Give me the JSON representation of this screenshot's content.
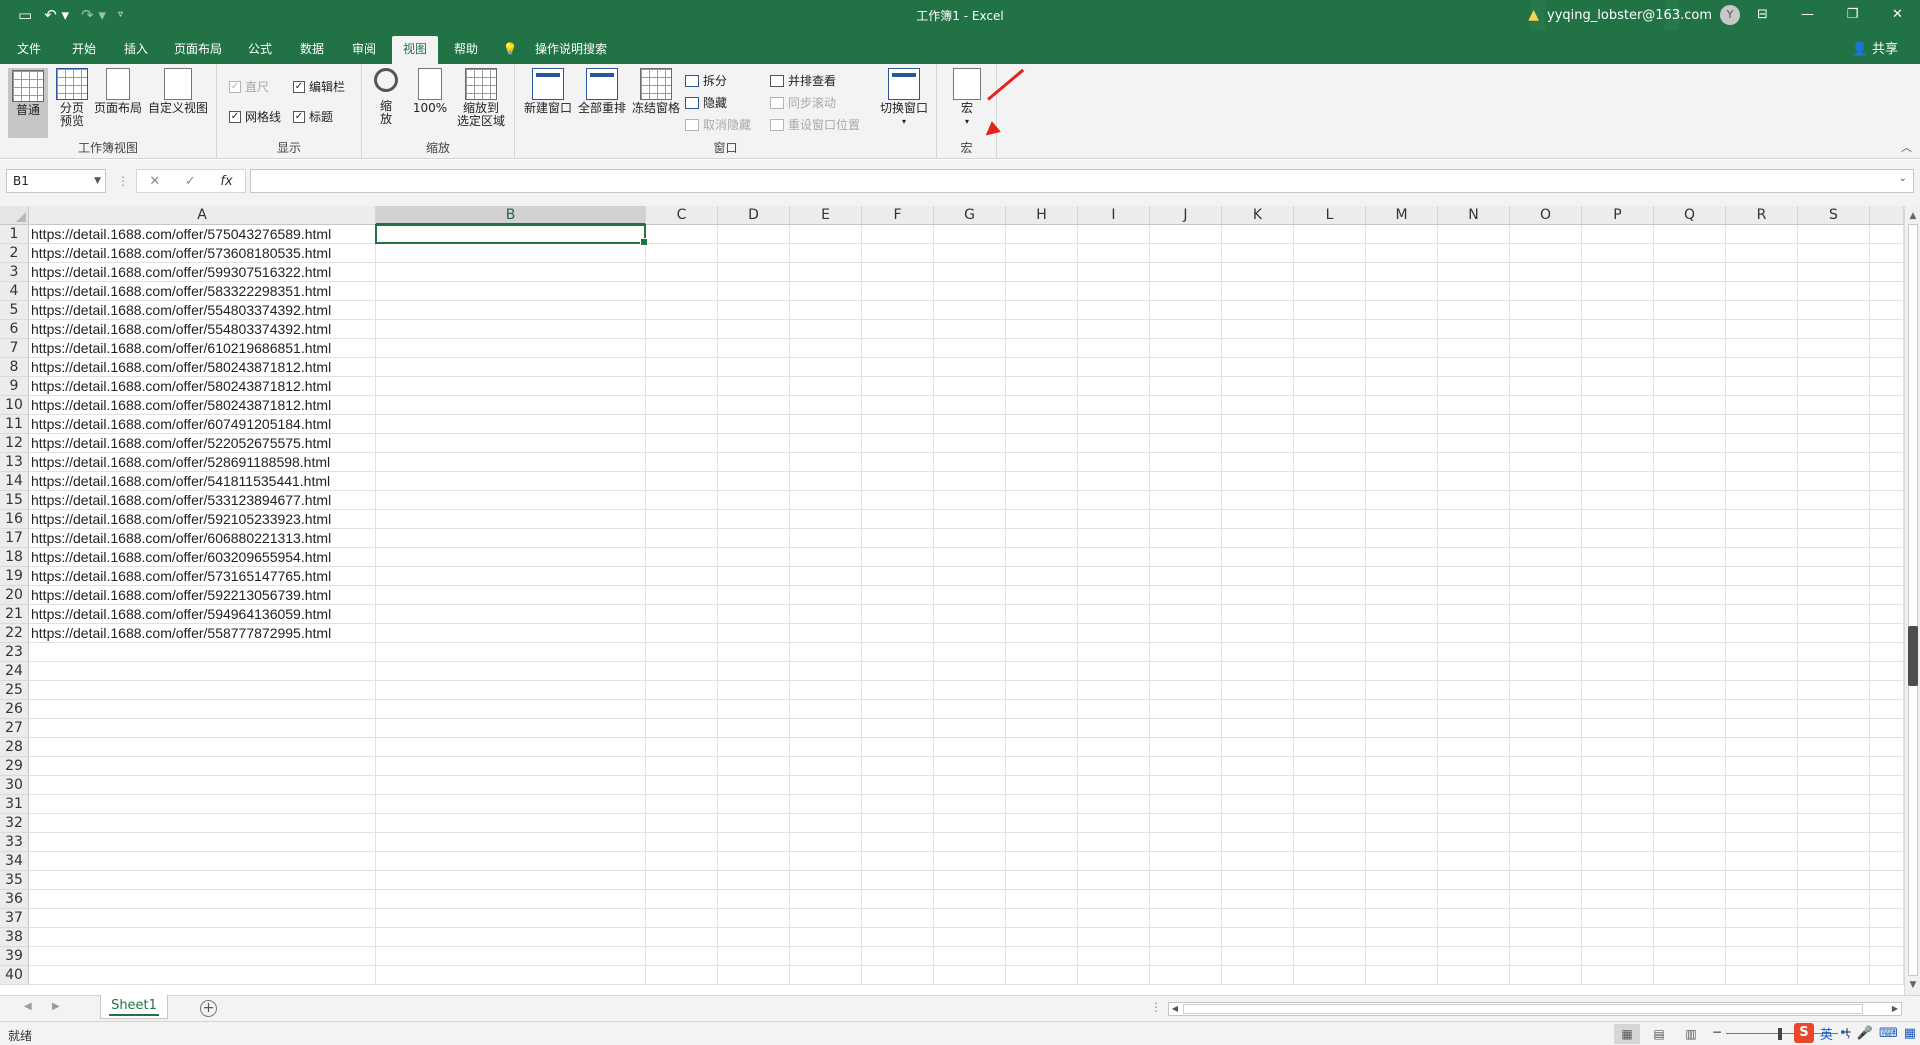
{
  "app": {
    "window_title": "工作簿1  -  Excel",
    "account": "yyqing_lobster@163.com",
    "avatar_initial": "Y",
    "share_label": "共享",
    "accent_color": "#217346"
  },
  "qat": {
    "save_icon": "save-icon",
    "undo_icon": "undo-icon",
    "redo_icon": "redo-icon",
    "customize_icon": "customize-qat-icon"
  },
  "tabs": [
    {
      "label": "文件"
    },
    {
      "label": "开始"
    },
    {
      "label": "插入"
    },
    {
      "label": "页面布局"
    },
    {
      "label": "公式"
    },
    {
      "label": "数据"
    },
    {
      "label": "审阅"
    },
    {
      "label": "视图"
    },
    {
      "label": "帮助"
    },
    {
      "label": "操作说明搜索"
    }
  ],
  "active_tab": "视图",
  "ribbon": {
    "workbook_views": {
      "label": "工作簿视图",
      "normal": "普通",
      "page_break_1": "分页",
      "page_break_2": "预览",
      "page_layout": "页面布局",
      "custom_views": "自定义视图"
    },
    "show": {
      "label": "显示",
      "ruler": "直尺",
      "formula_bar": "编辑栏",
      "gridlines": "网格线",
      "headings": "标题",
      "check": "✓"
    },
    "zoom": {
      "label": "缩放",
      "zoom_1": "缩",
      "zoom_2": "放",
      "zoom100": "100%",
      "zoom_sel_1": "缩放到",
      "zoom_sel_2": "选定区域"
    },
    "window": {
      "label": "窗口",
      "new_window": "新建窗口",
      "arrange_all": "全部重排",
      "freeze_panes": "冻结窗格",
      "split": "拆分",
      "hide": "隐藏",
      "unhide": "取消隐藏",
      "side_by_side": "并排查看",
      "sync_scroll": "同步滚动",
      "reset_position": "重设窗口位置",
      "switch_windows": "切换窗口"
    },
    "macros": {
      "label": "宏",
      "macros_button": "宏"
    }
  },
  "formula_bar": {
    "name_box": "B1",
    "cancel": "✕",
    "enter": "✓",
    "fx": "fx",
    "value": ""
  },
  "columns": [
    "A",
    "B",
    "C",
    "D",
    "E",
    "F",
    "G",
    "H",
    "I",
    "J",
    "K",
    "L",
    "M",
    "N",
    "O",
    "P",
    "Q",
    "R",
    "S"
  ],
  "selected_cell": "B1",
  "rows": [
    "https://detail.1688.com/offer/575043276589.html",
    "https://detail.1688.com/offer/573608180535.html",
    "https://detail.1688.com/offer/599307516322.html",
    "https://detail.1688.com/offer/583322298351.html",
    "https://detail.1688.com/offer/554803374392.html",
    "https://detail.1688.com/offer/554803374392.html",
    "https://detail.1688.com/offer/610219686851.html",
    "https://detail.1688.com/offer/580243871812.html",
    "https://detail.1688.com/offer/580243871812.html",
    "https://detail.1688.com/offer/580243871812.html",
    "https://detail.1688.com/offer/607491205184.html",
    "https://detail.1688.com/offer/522052675575.html",
    "https://detail.1688.com/offer/528691188598.html",
    "https://detail.1688.com/offer/541811535441.html",
    "https://detail.1688.com/offer/533123894677.html",
    "https://detail.1688.com/offer/592105233923.html",
    "https://detail.1688.com/offer/606880221313.html",
    "https://detail.1688.com/offer/603209655954.html",
    "https://detail.1688.com/offer/573165147765.html",
    "https://detail.1688.com/offer/592213056739.html",
    "https://detail.1688.com/offer/594964136059.html",
    "https://detail.1688.com/offer/558777872995.html"
  ],
  "row_numbers": [
    "1",
    "2",
    "3",
    "4",
    "5",
    "6",
    "7",
    "8",
    "9",
    "10",
    "11",
    "12",
    "13",
    "14",
    "15",
    "16",
    "17",
    "18",
    "19",
    "20",
    "21",
    "22",
    "23",
    "24",
    "25",
    "26",
    "27",
    "28",
    "29",
    "30",
    "31",
    "32",
    "33",
    "34",
    "35",
    "36",
    "37",
    "38",
    "39",
    "40"
  ],
  "sheets": [
    {
      "label": "Sheet1"
    }
  ],
  "add_sheet": "+",
  "status": {
    "text": "就绪",
    "ime_brand": "S",
    "ime_lang": "英"
  }
}
